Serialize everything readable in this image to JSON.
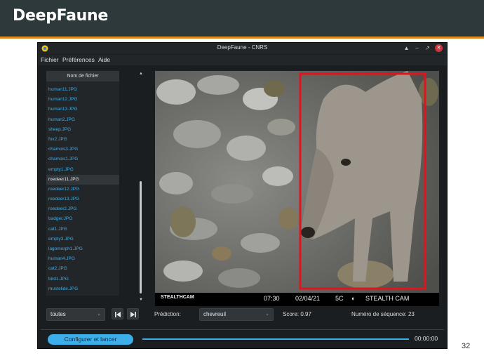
{
  "slide": {
    "title": "DeepFaune",
    "page_number": "32",
    "header_color": "#2e393c",
    "rule_color": "#e2891c"
  },
  "window": {
    "title": "DeepFaune - CNRS",
    "controls": [
      "▲",
      "–",
      "↗",
      "✕"
    ]
  },
  "menu": {
    "items": [
      "Fichier",
      "Préférences",
      "Aide"
    ]
  },
  "file_list": {
    "header": "Nom de fichier",
    "selected_index": 9,
    "files": [
      "human11.JPG",
      "human12.JPG",
      "human13.JPG",
      "human2.JPG",
      "sheep.JPG",
      "fox2.JPG",
      "chamois3.JPG",
      "chamois1.JPG",
      "empty1.JPG",
      "roedeer11.JPG",
      "roedeer12.JPG",
      "roedeer13.JPG",
      "roedeer2.JPG",
      "badger.JPG",
      "cat1.JPG",
      "empty3.JPG",
      "lagomorph1.JPG",
      "human4.JPG",
      "cat2.JPG",
      "bird1.JPG",
      "mustelide.JPG"
    ]
  },
  "image": {
    "description_icon": "camera-trap-photo",
    "detection_box_color": "#e0141e",
    "osd": {
      "brand_left": "STEALTHCAM",
      "time": "07:30",
      "date": "02/04/21",
      "temperature": "5C",
      "brand_right": "STEALTH CAM"
    }
  },
  "controls": {
    "filter_value": "toutes",
    "prediction_label": "Prédiction:",
    "prediction_value": "chevreuil",
    "score": "Score: 0.97",
    "sequence": "Numéro de séquence: 23"
  },
  "bottom": {
    "run_button_label": "Configurer et lancer",
    "time": "00:00:00",
    "progress": 1.0
  },
  "colors": {
    "accent": "#3daee9",
    "window_bg": "#1b1e20",
    "panel_bg": "#232629"
  }
}
